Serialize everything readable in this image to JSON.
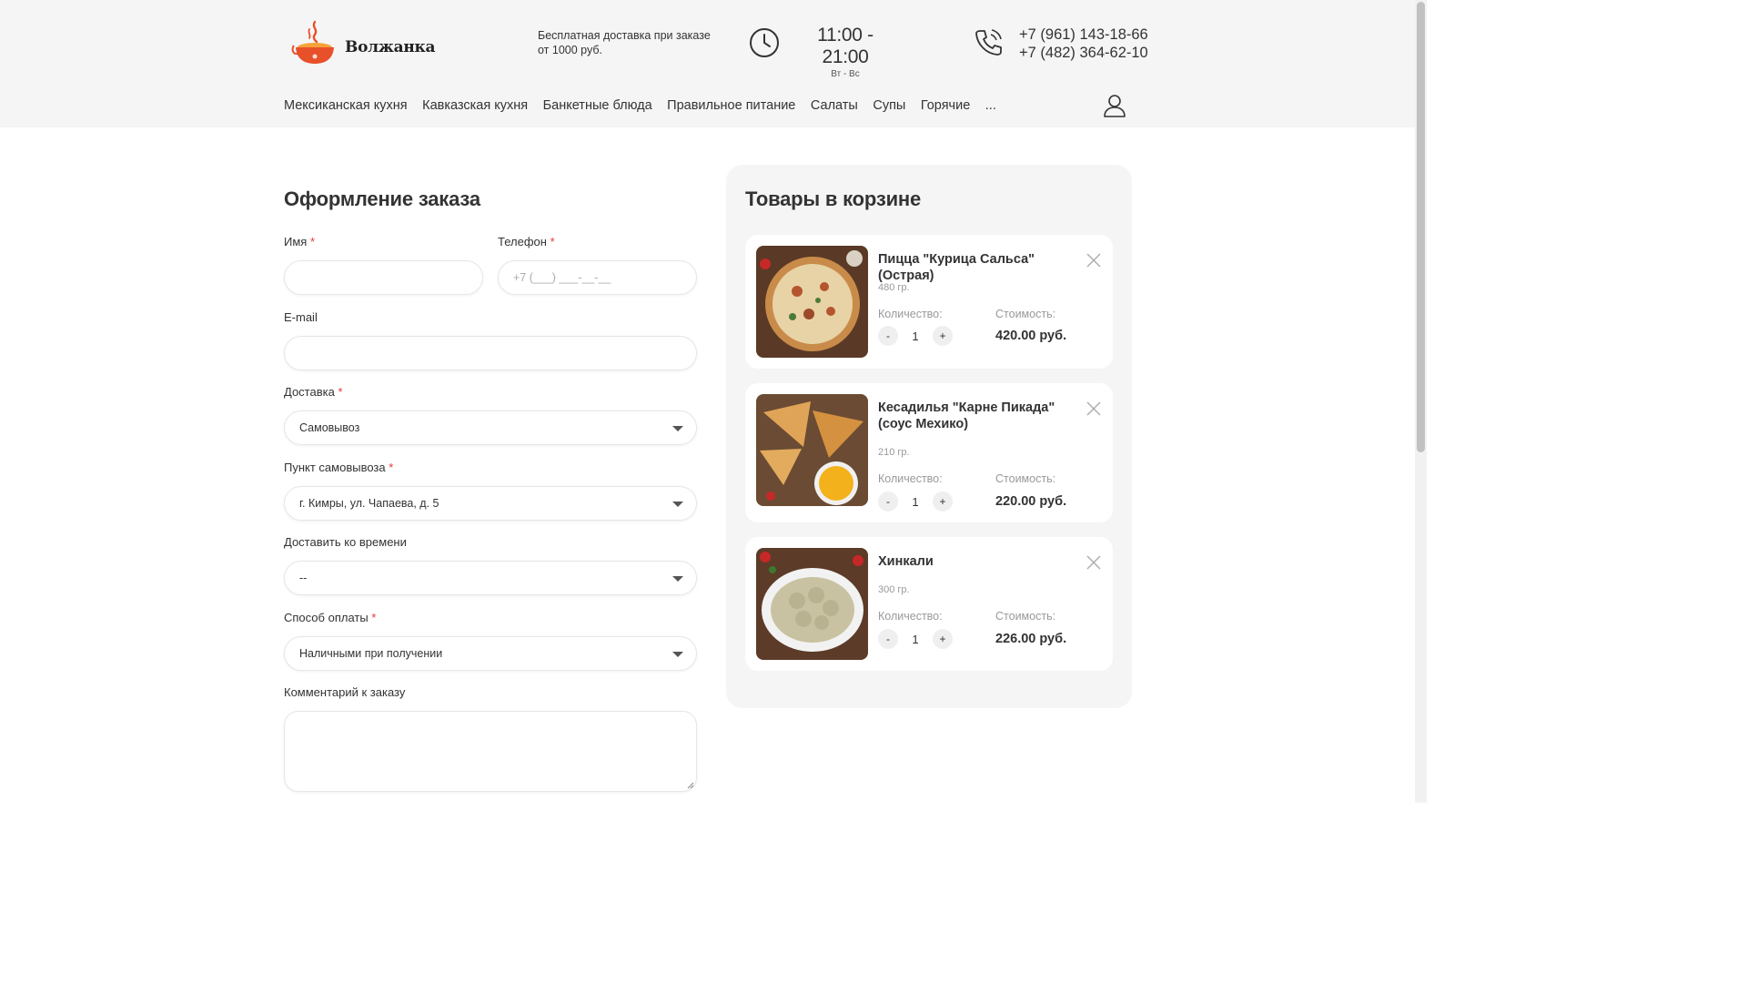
{
  "brand": {
    "name": "Волжанка",
    "accent": "#e8502a"
  },
  "header": {
    "delivery_note": "Бесплатная доставка при заказе от 1000 руб.",
    "hours_time": "11:00 - 21:00",
    "hours_days": "Вт - Вс",
    "phone_1": "+7 (961) 143-18-66",
    "phone_2": "+7 (482) 364-62-10"
  },
  "nav": {
    "items": [
      "Мексиканская кухня",
      "Кавказская кухня",
      "Банкетные блюда",
      "Правильное питание",
      "Салаты",
      "Супы",
      "Горячие",
      "..."
    ]
  },
  "form": {
    "title": "Оформление заказа",
    "name_label": "Имя",
    "phone_label": "Телефон",
    "phone_placeholder": "+7 (___) ___-__-__",
    "email_label": "E-mail",
    "delivery_label": "Доставка",
    "delivery_value": "Самовывоз",
    "pickup_label": "Пункт самовывоза",
    "pickup_value": "г. Кимры, ул. Чапаева, д. 5",
    "time_label": "Доставить ко времени",
    "time_value": "--",
    "payment_label": "Способ оплаты",
    "payment_value": "Наличными при получении",
    "comment_label": "Комментарий к заказу",
    "required_mark": "*"
  },
  "cart": {
    "title": "Товары в корзине",
    "qty_label": "Количество:",
    "cost_label": "Стоимость:",
    "minus": "-",
    "plus": "+",
    "items": [
      {
        "name": "Пицца \"Курица Сальса\" (Острая)",
        "weight": "480 гр.",
        "qty": "1",
        "price": "420.00 руб."
      },
      {
        "name": "Кесадилья \"Карне Пикада\" (соус Мехико)",
        "weight": "210 гр.",
        "qty": "1",
        "price": "220.00 руб."
      },
      {
        "name": "Хинкали",
        "weight": "300 гр.",
        "qty": "1",
        "price": "226.00 руб."
      }
    ]
  }
}
